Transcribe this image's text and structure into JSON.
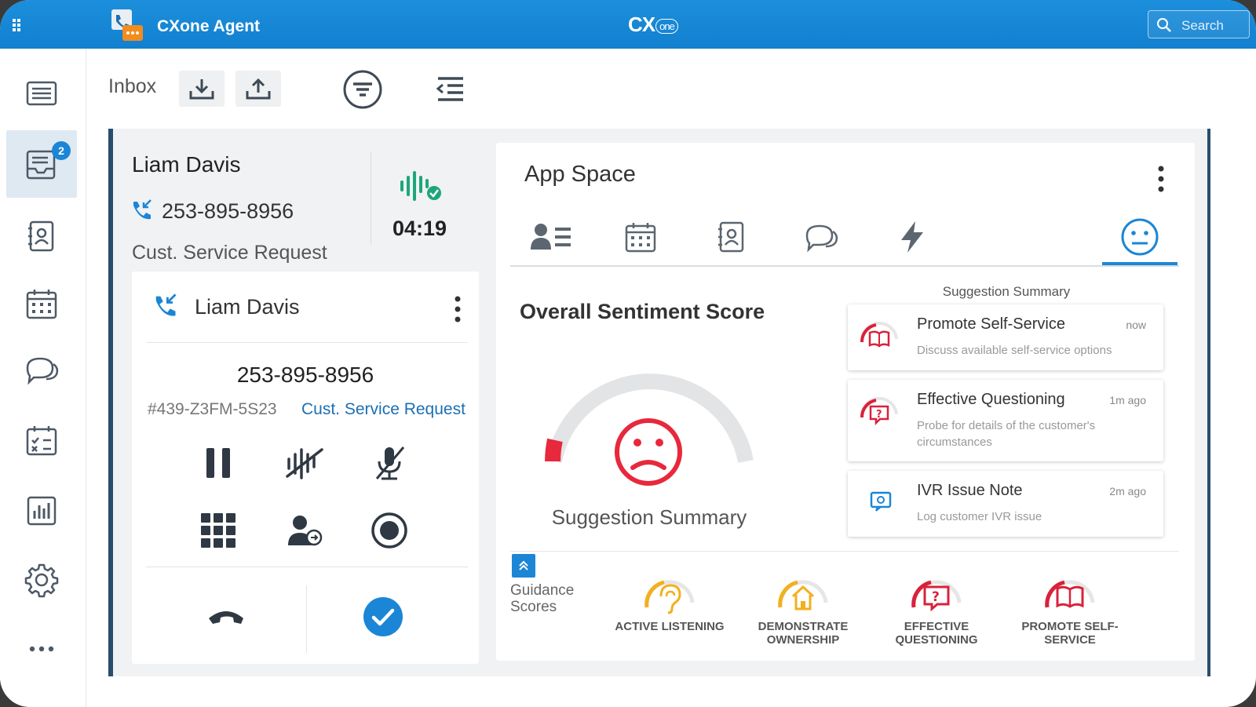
{
  "topbar": {
    "app_title": "CXone Agent",
    "brand": "CX",
    "brand_suffix": "one",
    "search_placeholder": "Search"
  },
  "leftnav": {
    "items": [
      {
        "name": "menu",
        "icon": "menu-lines-icon"
      },
      {
        "name": "inbox",
        "icon": "inbox-icon",
        "badge": "2",
        "active": true
      },
      {
        "name": "contacts",
        "icon": "contact-book-icon"
      },
      {
        "name": "calendar",
        "icon": "calendar-icon"
      },
      {
        "name": "chat",
        "icon": "chat-bubbles-icon"
      },
      {
        "name": "schedule",
        "icon": "schedule-checklist-icon"
      },
      {
        "name": "reports",
        "icon": "bar-chart-icon"
      },
      {
        "name": "settings",
        "icon": "gear-icon"
      },
      {
        "name": "more",
        "icon": "ellipsis-icon"
      }
    ]
  },
  "toolbar": {
    "inbox_label": "Inbox"
  },
  "contact": {
    "name": "Liam Davis",
    "phone": "253-895-8956",
    "reason": "Cust. Service Request",
    "timer": "04:19"
  },
  "call_card": {
    "name": "Liam Davis",
    "phone": "253-895-8956",
    "contact_id": "#439-Z3FM-5S23",
    "reason": "Cust. Service Request"
  },
  "appspace": {
    "title": "App Space",
    "tabs": [
      "customer-card-icon",
      "calendar-icon",
      "contact-book-icon",
      "chat-bubbles-icon",
      "lightning-icon",
      "sentiment-face-icon"
    ],
    "active_tab": 5
  },
  "sentiment": {
    "title": "Overall Sentiment Score",
    "caption": "Suggestion Summary",
    "level": 0.07,
    "color": "#e8283c"
  },
  "suggestions": {
    "header": "Suggestion Summary",
    "items": [
      {
        "title": "Promote Self-Service",
        "time": "now",
        "desc": "Discuss available self-service options"
      },
      {
        "title": "Effective Questioning",
        "time": "1m ago",
        "desc": "Probe for details of the customer's circumstances"
      },
      {
        "title": "IVR Issue Note",
        "time": "2m ago",
        "desc": "Log customer IVR issue"
      }
    ]
  },
  "guidance": {
    "label": "Guidance Scores",
    "scores": [
      {
        "label": "ACTIVE LISTENING",
        "color": "#f2b01e",
        "level": 0.35
      },
      {
        "label": "DEMONSTRATE OWNERSHIP",
        "color": "#f2b01e",
        "level": 0.35
      },
      {
        "label": "EFFECTIVE QUESTIONING",
        "color": "#d9223a",
        "level": 0.3
      },
      {
        "label": "PROMOTE SELF-SERVICE",
        "color": "#d9223a",
        "level": 0.3
      }
    ]
  }
}
